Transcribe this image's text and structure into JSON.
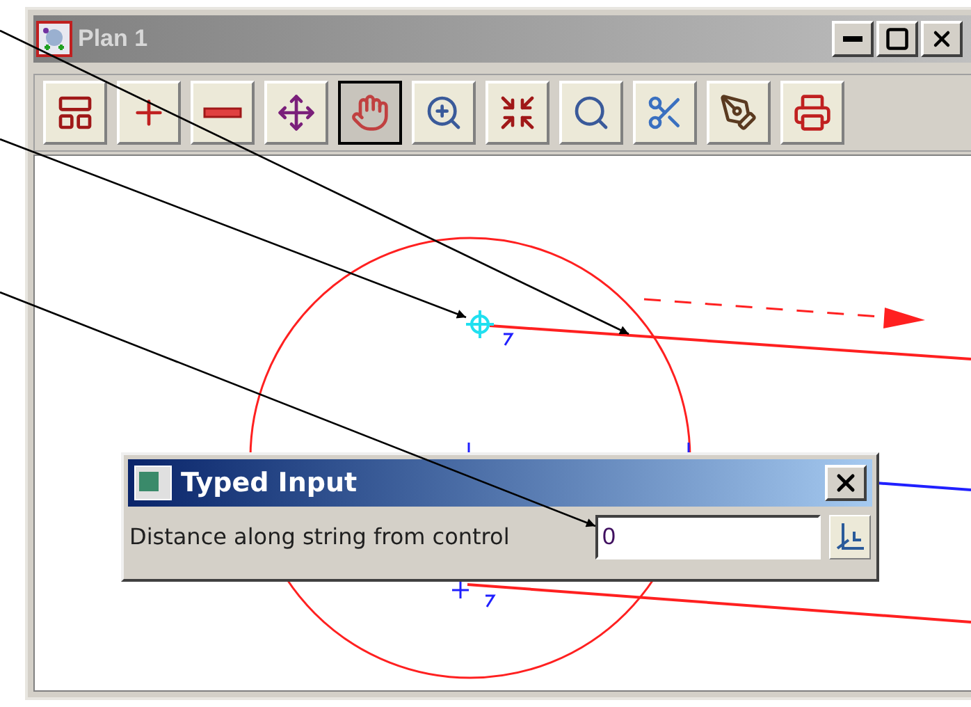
{
  "window": {
    "title": "Plan 1"
  },
  "toolbar": [
    {
      "selected": false
    },
    {
      "selected": false
    },
    {
      "selected": false
    },
    {
      "selected": false
    },
    {
      "selected": true
    },
    {
      "selected": false
    },
    {
      "selected": false
    },
    {
      "selected": false
    },
    {
      "selected": false
    },
    {
      "selected": false
    },
    {
      "selected": false
    }
  ],
  "dialog": {
    "title": "Typed Input",
    "label": "Distance along string from control",
    "value": "0"
  }
}
